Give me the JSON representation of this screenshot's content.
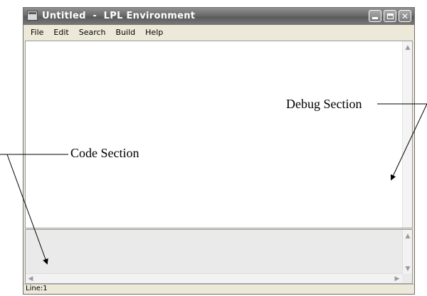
{
  "window": {
    "title": "Untitled  -  LPL Environment"
  },
  "menu": [
    "File",
    "Edit",
    "Search",
    "Build",
    "Help"
  ],
  "status": {
    "line": "Line:1"
  },
  "annotations": {
    "debug_label": "Debug Section",
    "code_label": "Code Section"
  }
}
